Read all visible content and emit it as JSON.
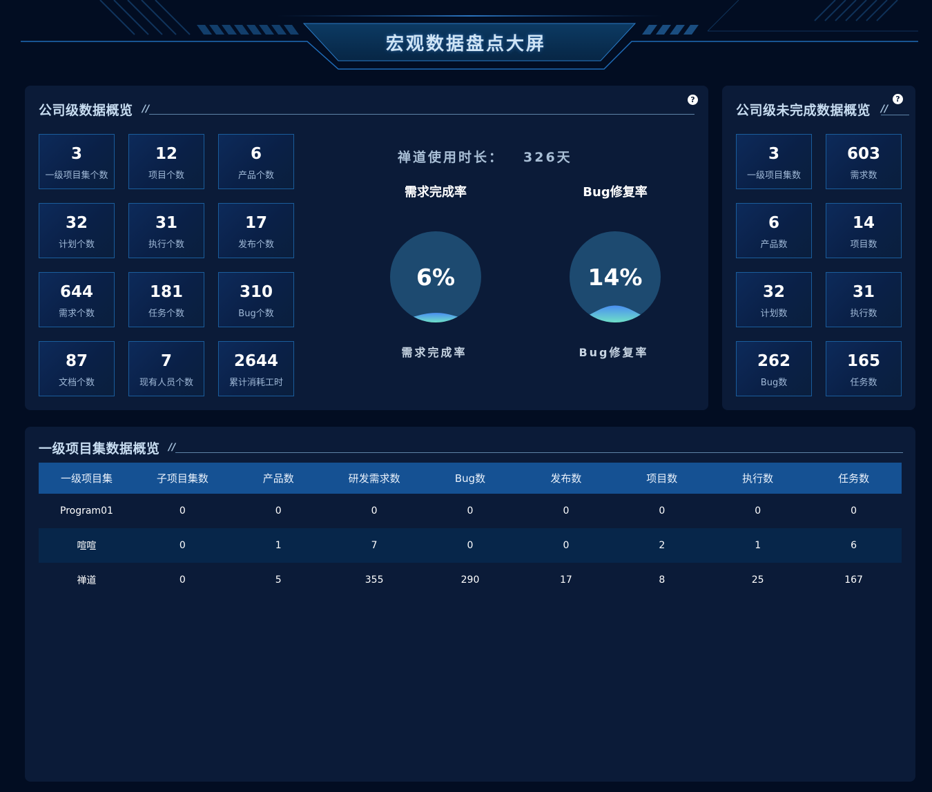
{
  "header": {
    "title": "宏观数据盘点大屏"
  },
  "company_overview": {
    "title": "公司级数据概览",
    "title_deco": "//",
    "help": "?",
    "stats": [
      {
        "value": "3",
        "label": "一级项目集个数"
      },
      {
        "value": "12",
        "label": "项目个数"
      },
      {
        "value": "6",
        "label": "产品个数"
      },
      {
        "value": "32",
        "label": "计划个数"
      },
      {
        "value": "31",
        "label": "执行个数"
      },
      {
        "value": "17",
        "label": "发布个数"
      },
      {
        "value": "644",
        "label": "需求个数"
      },
      {
        "value": "181",
        "label": "任务个数"
      },
      {
        "value": "310",
        "label": "Bug个数"
      },
      {
        "value": "87",
        "label": "文档个数"
      },
      {
        "value": "7",
        "label": "现有人员个数"
      },
      {
        "value": "2644",
        "label": "累计消耗工时"
      }
    ],
    "usage": {
      "label": "禅道使用时长：",
      "value": "326天"
    },
    "gauges": [
      {
        "title": "需求完成率",
        "percent": 6,
        "percent_text": "6%",
        "label": "需求完成率"
      },
      {
        "title": "Bug修复率",
        "percent": 14,
        "percent_text": "14%",
        "label": "Bug修复率"
      }
    ]
  },
  "unfinished_overview": {
    "title": "公司级未完成数据概览",
    "title_deco": "//",
    "help": "?",
    "stats": [
      {
        "value": "3",
        "label": "一级项目集数"
      },
      {
        "value": "603",
        "label": "需求数"
      },
      {
        "value": "6",
        "label": "产品数"
      },
      {
        "value": "14",
        "label": "项目数"
      },
      {
        "value": "32",
        "label": "计划数"
      },
      {
        "value": "31",
        "label": "执行数"
      },
      {
        "value": "262",
        "label": "Bug数"
      },
      {
        "value": "165",
        "label": "任务数"
      }
    ]
  },
  "program_overview": {
    "title": "一级项目集数据概览",
    "title_deco": "//",
    "columns": [
      "一级项目集",
      "子项目集数",
      "产品数",
      "研发需求数",
      "Bug数",
      "发布数",
      "项目数",
      "执行数",
      "任务数"
    ],
    "rows": [
      [
        "Program01",
        "0",
        "0",
        "0",
        "0",
        "0",
        "0",
        "0",
        "0"
      ],
      [
        "喧喧",
        "0",
        "1",
        "7",
        "0",
        "0",
        "2",
        "1",
        "6"
      ],
      [
        "禅道",
        "0",
        "5",
        "355",
        "290",
        "17",
        "8",
        "25",
        "167"
      ]
    ]
  },
  "colors": {
    "background": "#020d22",
    "panel": "#0b1b38",
    "card_border": "#1a5d9c",
    "table_header": "#155193",
    "table_alt_row": "#07264a",
    "gauge_circle": "#1d4a70",
    "wave_top": "#4a8ff0",
    "wave_bottom": "#6fe0c8"
  }
}
